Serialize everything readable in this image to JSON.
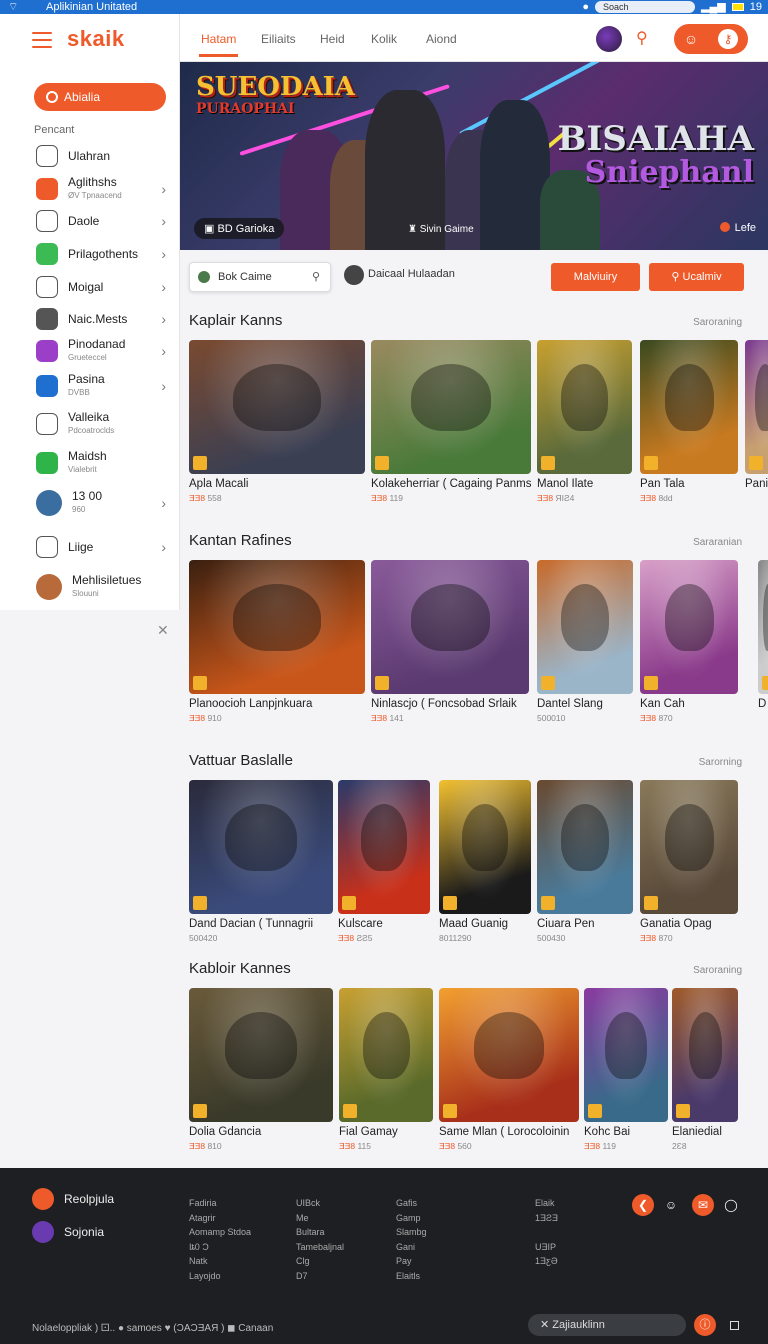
{
  "status_bar": {
    "title": "Aplikinian Unitated",
    "search": "Soach",
    "time": "19"
  },
  "sidebar": {
    "brand": "skaik",
    "cta": "Abialia",
    "section": "Pencant",
    "items": [
      {
        "label": "Ulahran",
        "sub": "",
        "icon": "ticket-icon",
        "color": "#ffffff",
        "chev": false
      },
      {
        "label": "Aglithshs",
        "sub": "ØV Tpnaacend",
        "icon": "gamepad-icon",
        "color": "#ef5a2a",
        "chev": true
      },
      {
        "label": "Daole",
        "sub": "",
        "icon": "calendar-icon",
        "color": "#ffffff",
        "chev": true
      },
      {
        "label": "Prilagothents",
        "sub": "",
        "icon": "shopping-bag-icon",
        "color": "#3cba54",
        "chev": true
      },
      {
        "label": "Moigal",
        "sub": "",
        "icon": "tablet-icon",
        "color": "#ffffff",
        "chev": true
      },
      {
        "label": "Naic.Mests",
        "sub": "",
        "icon": "check-badge-icon",
        "color": "#555555",
        "chev": true
      },
      {
        "label": "Pinodanad",
        "sub": "Grueteccel",
        "icon": "sparkle-icon",
        "color": "#9b3fc8",
        "chev": true
      },
      {
        "label": "Pasina",
        "sub": "DVBB",
        "icon": "person-icon",
        "color": "#1e6fd0",
        "chev": true
      },
      {
        "label": "Valleika",
        "sub": "Pdcoatroclds",
        "icon": "info-card-icon",
        "color": "#ffffff",
        "chev": false
      },
      {
        "label": "Maidsh",
        "sub": "Vialebrit",
        "icon": "music-icon",
        "color": "#2fb44a",
        "chev": false
      },
      {
        "label": "13 00",
        "sub": "960",
        "icon": "avatar-icon",
        "color": "#3a6da0",
        "chev": true
      },
      {
        "label": "Liige",
        "sub": "",
        "icon": "image-icon",
        "color": "#ffffff",
        "chev": true
      },
      {
        "label": "Mehlisiletues",
        "sub": "Slouuni",
        "icon": "avatar-icon",
        "color": "#b86a3a",
        "chev": false
      }
    ]
  },
  "topnav": {
    "tabs": [
      "Hatam",
      "Eiliaits",
      "Heid",
      "Kolik",
      "Aiond"
    ]
  },
  "hero": {
    "logo_left_1": "SUEODAIA",
    "logo_left_2": "PURAOPHAI",
    "logo_right_1": "BISAIAHA",
    "logo_right_2": "Sniephanl",
    "chip": "BD Garioka",
    "center_label": "Sivin Gaime",
    "live_label": "Lefe"
  },
  "filters": {
    "search": "Bok Caime",
    "label": "Daicaal Hulaadan",
    "btn1": "Malviuiry",
    "btn2": "Ucalmiv"
  },
  "sections": [
    {
      "title": "Kaplair Kanns",
      "more": "Saroraning",
      "cards": [
        {
          "name": "Apla Macali",
          "meta_a": "ƎƎ8",
          "meta_b": "558",
          "c1": "#3b3f52",
          "c2": "#7a4a30"
        },
        {
          "name": "Kolakeherriar ( Cagaing Panms",
          "meta_a": "ƎƎ8",
          "meta_b": "119",
          "c1": "#4a7a3a",
          "c2": "#9a8a60"
        },
        {
          "name": "Manol Ilate",
          "meta_a": "ƎƎ8",
          "meta_b": "ЯIƧ4",
          "c1": "#5a6a3a",
          "c2": "#c8a030"
        },
        {
          "name": "Pan Tala",
          "meta_a": "ƎƎ8",
          "meta_b": "8dd",
          "c1": "#c87a20",
          "c2": "#3a4a20"
        },
        {
          "name": "Pani",
          "meta_a": "",
          "meta_b": "",
          "c1": "#c8a070",
          "c2": "#7a3a90"
        }
      ]
    },
    {
      "title": "Kantan Rafines",
      "more": "Sararanian",
      "cards": [
        {
          "name": "Planoocioh Lanpjnkuara",
          "meta_a": "ƎƎ8",
          "meta_b": "910",
          "c1": "#c8561a",
          "c2": "#3a2010"
        },
        {
          "name": "Ninlascjo ( Foncsobad Srlaik",
          "meta_a": "ƎƎ8",
          "meta_b": "141",
          "c1": "#5a3a70",
          "c2": "#8a5a9a"
        },
        {
          "name": "Dantel Slang",
          "meta_a": "",
          "meta_b": "500010",
          "c1": "#9ab4c8",
          "c2": "#c86a2a"
        },
        {
          "name": "Kan Cah",
          "meta_a": "ƎƎ8",
          "meta_b": "870",
          "c1": "#8a3a8a",
          "c2": "#d8a0c8"
        },
        {
          "name": "D",
          "meta_a": "",
          "meta_b": "",
          "c1": "#cccccc",
          "c2": "#888888"
        }
      ]
    },
    {
      "title": "Vattuar Baslalle",
      "more": "Sarorning",
      "cards": [
        {
          "name": "Dand Dacian ( Tunnagrii",
          "meta_a": "",
          "meta_b": "500420",
          "c1": "#3a4a7a",
          "c2": "#2a2a3a"
        },
        {
          "name": "Kulscare",
          "meta_a": "ƎƎ8",
          "meta_b": "ƧƧ5",
          "c1": "#c8301a",
          "c2": "#2a3a6a"
        },
        {
          "name": "Maad Guanig",
          "meta_a": "",
          "meta_b": "8011290",
          "c1": "#1a1a1a",
          "c2": "#f2c030"
        },
        {
          "name": "Ciuara Pen",
          "meta_a": "",
          "meta_b": "500430",
          "c1": "#4a7a9a",
          "c2": "#6a4a30"
        },
        {
          "name": "Ganatia Opag",
          "meta_a": "ƎƎ8",
          "meta_b": "870",
          "c1": "#5a4a3a",
          "c2": "#8a7a5a"
        }
      ]
    },
    {
      "title": "Kabloir Kannes",
      "more": "Saroraning",
      "cards": [
        {
          "name": "Dolia Gdancia",
          "meta_a": "ƎƎ8",
          "meta_b": "810",
          "c1": "#3a3a2a",
          "c2": "#6a5a3a"
        },
        {
          "name": "Fial Gamay",
          "meta_a": "ƎƎ8",
          "meta_b": "115",
          "c1": "#5a6a2a",
          "c2": "#c8a030"
        },
        {
          "name": "Same Mlan ( Lorocoloinin",
          "meta_a": "ƎƎ8",
          "meta_b": "560",
          "c1": "#a8301a",
          "c2": "#f2a030"
        },
        {
          "name": "Kohc Bai",
          "meta_a": "ƎƎ8",
          "meta_b": "119",
          "c1": "#3a6a8a",
          "c2": "#8a3aa0"
        },
        {
          "name": "Elaniedial",
          "meta_a": "",
          "meta_b": "2Ɛ8",
          "c1": "#4a3a6a",
          "c2": "#a05a2a"
        }
      ]
    }
  ],
  "footer": {
    "link1": "Reolpjula",
    "link2": "Sojonia",
    "col1": [
      "Fadiria",
      "Atagrir",
      "Aomamp Stdoa",
      "Iȶ0 Ɔ",
      "Natk",
      "Layojdo"
    ],
    "col2": [
      "UIBck",
      "Me",
      "Bultara",
      "Tamebaljnal",
      "Clg",
      "D7"
    ],
    "col3": [
      "Gafis",
      "Gamp",
      "Slambg",
      "Gani",
      "Pay",
      "Elaitls"
    ],
    "col4": [
      "Elaik",
      "1ƎƧƎ",
      "",
      "UƎIP",
      "1ƎƹƏ",
      ""
    ],
    "bottom": "Nolaeloppliak )  ⚀..  ● samoes   ♥  (ƆAƆƎAЯ )   ◼ Canaan",
    "pill": "Zajiauklinn"
  }
}
